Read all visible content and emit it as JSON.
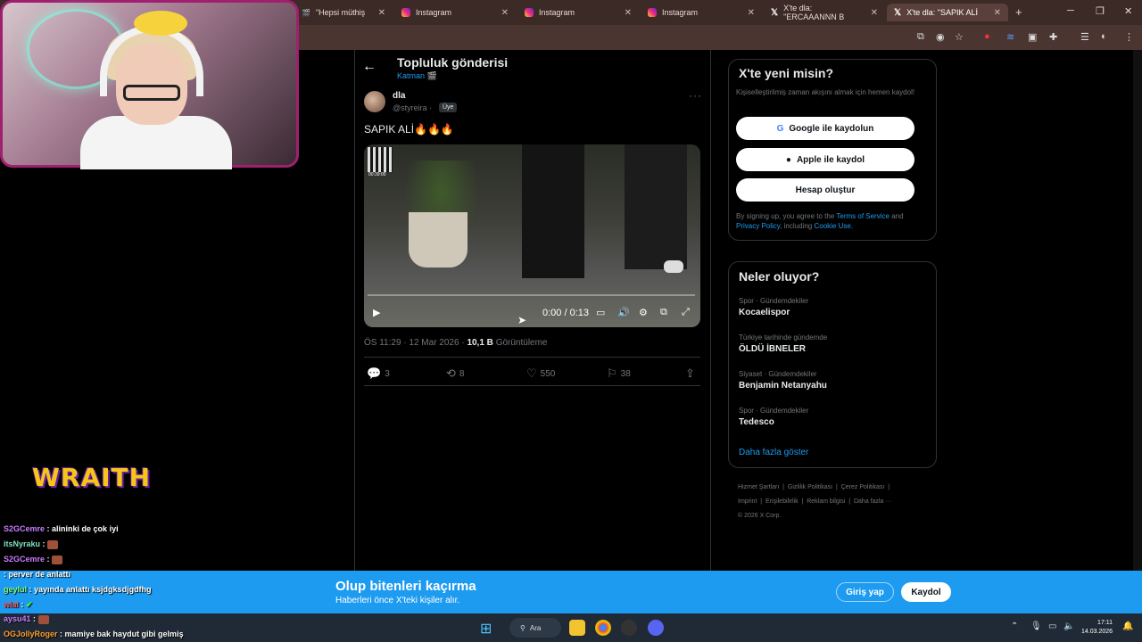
{
  "browser": {
    "tabs": [
      {
        "label": "\"Hepsi müthiş",
        "icon": "video-icon"
      },
      {
        "label": "Instagram",
        "icon": "instagram-icon"
      },
      {
        "label": "Instagram",
        "icon": "instagram-icon"
      },
      {
        "label": "Instagram",
        "icon": "instagram-icon"
      },
      {
        "label": "X'te dla: \"ERCAAANNN B",
        "icon": "x-icon"
      },
      {
        "label": "X'te dla: \"SAPIK ALİ",
        "icon": "x-icon"
      }
    ],
    "new_tab": "+",
    "close_glyph": "✕"
  },
  "header": {
    "back": "←",
    "title": "Topluluk gönderisi",
    "subtitle": "Katman 🎬"
  },
  "post": {
    "author_name": "dla",
    "author_handle": "@styreira ·",
    "badge": "Üye",
    "more": "···",
    "text": "SAPIK ALİ🔥🔥🔥",
    "video": {
      "qr_time": "00:39:00",
      "time": "0:00 / 0:13",
      "progress": 0
    },
    "timestamp": "ÖS 11:29 · 12 Mar 2026 ·",
    "views_count": "10,1 B",
    "views_label": "Görüntüleme",
    "actions": {
      "replies": "3",
      "reposts": "8",
      "likes": "550",
      "bookmarks": "38"
    }
  },
  "signup": {
    "title": "X'te yeni misin?",
    "desc": "Kişiselleştirilmiş zaman akışını almak için hemen kaydol!",
    "google": "Google ile kaydolun",
    "apple": "Apple ile kaydol",
    "create": "Hesap oluştur",
    "legal_prefix": "By signing up, you agree to the",
    "terms": "Terms of Service",
    "legal_and": "and",
    "privacy": "Privacy Policy",
    "legal_incl": ", including",
    "cookie": "Cookie Use."
  },
  "trends": {
    "title": "Neler oluyor?",
    "items": [
      {
        "category": "Spor · Gündemdekiler",
        "name": "Kocaelispor"
      },
      {
        "category": "Türkiye tarihinde gündemde",
        "name": "ÖLDÜ İBNELER"
      },
      {
        "category": "Siyaset · Gündemdekiler",
        "name": "Benjamin Netanyahu"
      },
      {
        "category": "Spor · Gündemdekiler",
        "name": "Tedesco"
      }
    ],
    "show_more": "Daha fazla göster"
  },
  "footer": {
    "links": [
      "Hizmet Şartları",
      "Gizlilik Politikası",
      "Çerez Politikası",
      "Imprint",
      "Erişilebilirlik",
      "Reklam bilgisi",
      "Daha fazla ···"
    ],
    "copyright": "© 2026 X Corp."
  },
  "banner": {
    "title": "Olup bitenleri kaçırma",
    "subtitle": "Haberleri önce X'teki kişiler alır.",
    "login": "Giriş yap",
    "signup": "Kaydol"
  },
  "taskbar": {
    "search": "Ara",
    "time": "17:11",
    "date": "14.03.2026"
  },
  "overlay": {
    "logo": "WRAITH",
    "chat": [
      {
        "user": "S2GCemre",
        "color": "#c77dff",
        "msg": ": alininki de çok iyi"
      },
      {
        "user": "itsNyraku",
        "color": "#7fe3c2",
        "msg": ":"
      },
      {
        "user": "S2GCemre",
        "color": "#c77dff",
        "msg": ":"
      },
      {
        "user": "",
        "color": "#ff6060",
        "msg": ": perver de anlattı"
      },
      {
        "user": "geylul",
        "color": "#7fff7f",
        "msg": ": yayında anlattı ksjdgksdjgdfhg"
      },
      {
        "user": "wial",
        "color": "#ff5050",
        "msg": ":"
      },
      {
        "user": "aysu41",
        "color": "#c77dff",
        "msg": ":"
      },
      {
        "user": "OGJollyRoger",
        "color": "#ffa030",
        "msg": ": mamiye bak haydut gibi gelmiş"
      }
    ]
  },
  "colors": {
    "accent": "#1d9bf0",
    "banner": "#1d9bf0",
    "background": "#000000"
  }
}
